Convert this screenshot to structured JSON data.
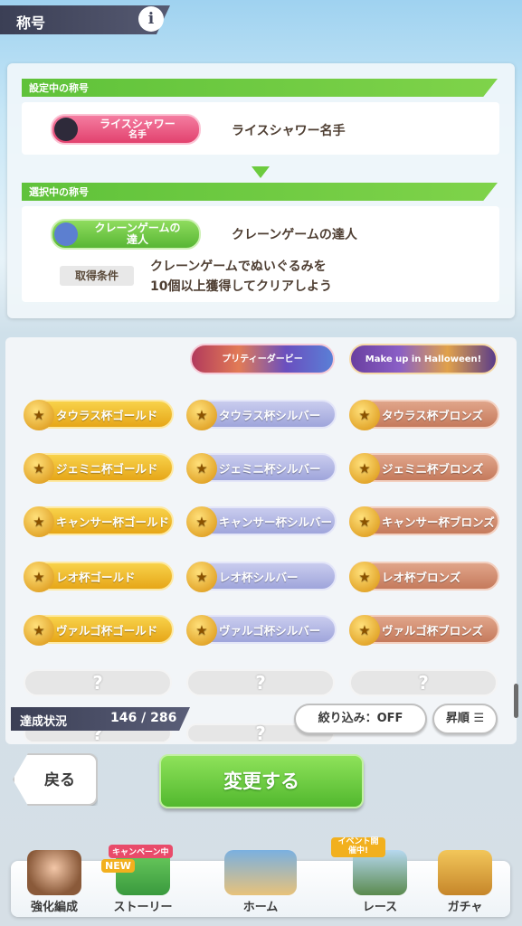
{
  "header": {
    "title": "称号",
    "info_icon": "i"
  },
  "current": {
    "bar_label": "設定中の称号",
    "badge_line1": "ライスシャワー",
    "badge_line2": "名手",
    "title": "ライスシャワー名手"
  },
  "selected": {
    "bar_label": "選択中の称号",
    "badge_line1": "クレーンゲームの",
    "badge_line2": "達人",
    "title": "クレーンゲームの達人",
    "condition_label": "取得条件",
    "condition_line1": "クレーンゲームでぬいぐるみを",
    "condition_line2": "10個以上獲得してクリアしよう"
  },
  "banners": [
    "プリティーダービー",
    "Make up in Halloween!"
  ],
  "badges": [
    [
      "タウラス杯ゴールド",
      "タウラス杯シルバー",
      "タウラス杯ブロンズ"
    ],
    [
      "ジェミニ杯ゴールド",
      "ジェミニ杯シルバー",
      "ジェミニ杯ブロンズ"
    ],
    [
      "キャンサー杯ゴールド",
      "キャンサー杯シルバー",
      "キャンサー杯ブロンズ"
    ],
    [
      "レオ杯ゴールド",
      "レオ杯シルバー",
      "レオ杯ブロンズ"
    ],
    [
      "ヴァルゴ杯ゴールド",
      "ヴァルゴ杯シルバー",
      "ヴァルゴ杯ブロンズ"
    ]
  ],
  "unknown": "?",
  "status": {
    "label": "達成状況",
    "value": "146 / 286"
  },
  "filter_label": "絞り込み：OFF",
  "sort_label": "昇順",
  "back_label": "戻る",
  "change_label": "変更する",
  "nav": {
    "items": [
      "強化編成",
      "ストーリー",
      "ホーム",
      "レース",
      "ガチャ"
    ],
    "story_tag": "キャンペーン中",
    "story_new": "NEW",
    "race_tag": "イベント開催中!"
  },
  "colors": {
    "accent_green": "#6ccb3e",
    "header_dark": "#3b3f55",
    "gold": "#e6a618",
    "silver": "#9fa5db",
    "bronze": "#c57a5c"
  }
}
